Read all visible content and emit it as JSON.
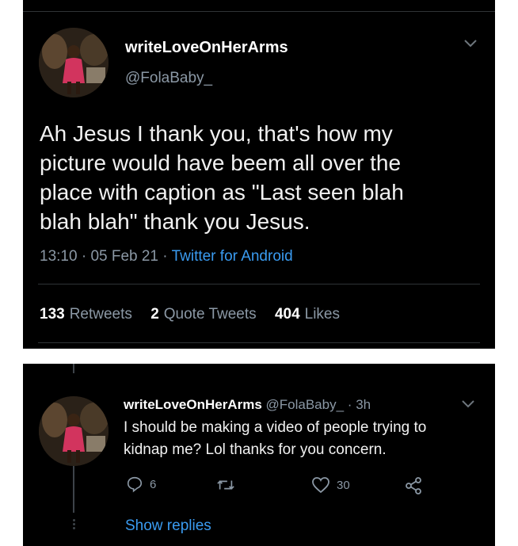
{
  "tweet": {
    "author_name": "writeLoveOnHerArms",
    "author_handle": "@FolaBaby_",
    "text_lines": [
      "Ah Jesus I thank you, that's how my",
      "picture would have beem all over the",
      "place with caption as \"Last seen blah",
      "blah blah\" thank you Jesus."
    ],
    "time": "13:10",
    "date": "05 Feb 21",
    "source": "Twitter for Android",
    "stats": {
      "retweets_count": "133",
      "retweets_label": "Retweets",
      "quotes_count": "2",
      "quotes_label": "Quote Tweets",
      "likes_count": "404",
      "likes_label": "Likes"
    },
    "avatar_icon": "profile-photo",
    "menu_icon": "chevron-down-icon"
  },
  "reply": {
    "author_name": "writeLoveOnHerArms",
    "author_handle": "@FolaBaby_",
    "age": "3h",
    "text_lines": [
      "I should be making a video of people trying to",
      "kidnap me? Lol thanks for you concern."
    ],
    "actions": {
      "reply_count": "6",
      "retweet_count": "",
      "like_count": "30"
    },
    "show_replies": "Show replies"
  },
  "colors": {
    "background": "#000000",
    "text": "#e7e9ea",
    "secondary": "#8b98a5",
    "link": "#3a9bf0",
    "divider": "#2f3336"
  }
}
